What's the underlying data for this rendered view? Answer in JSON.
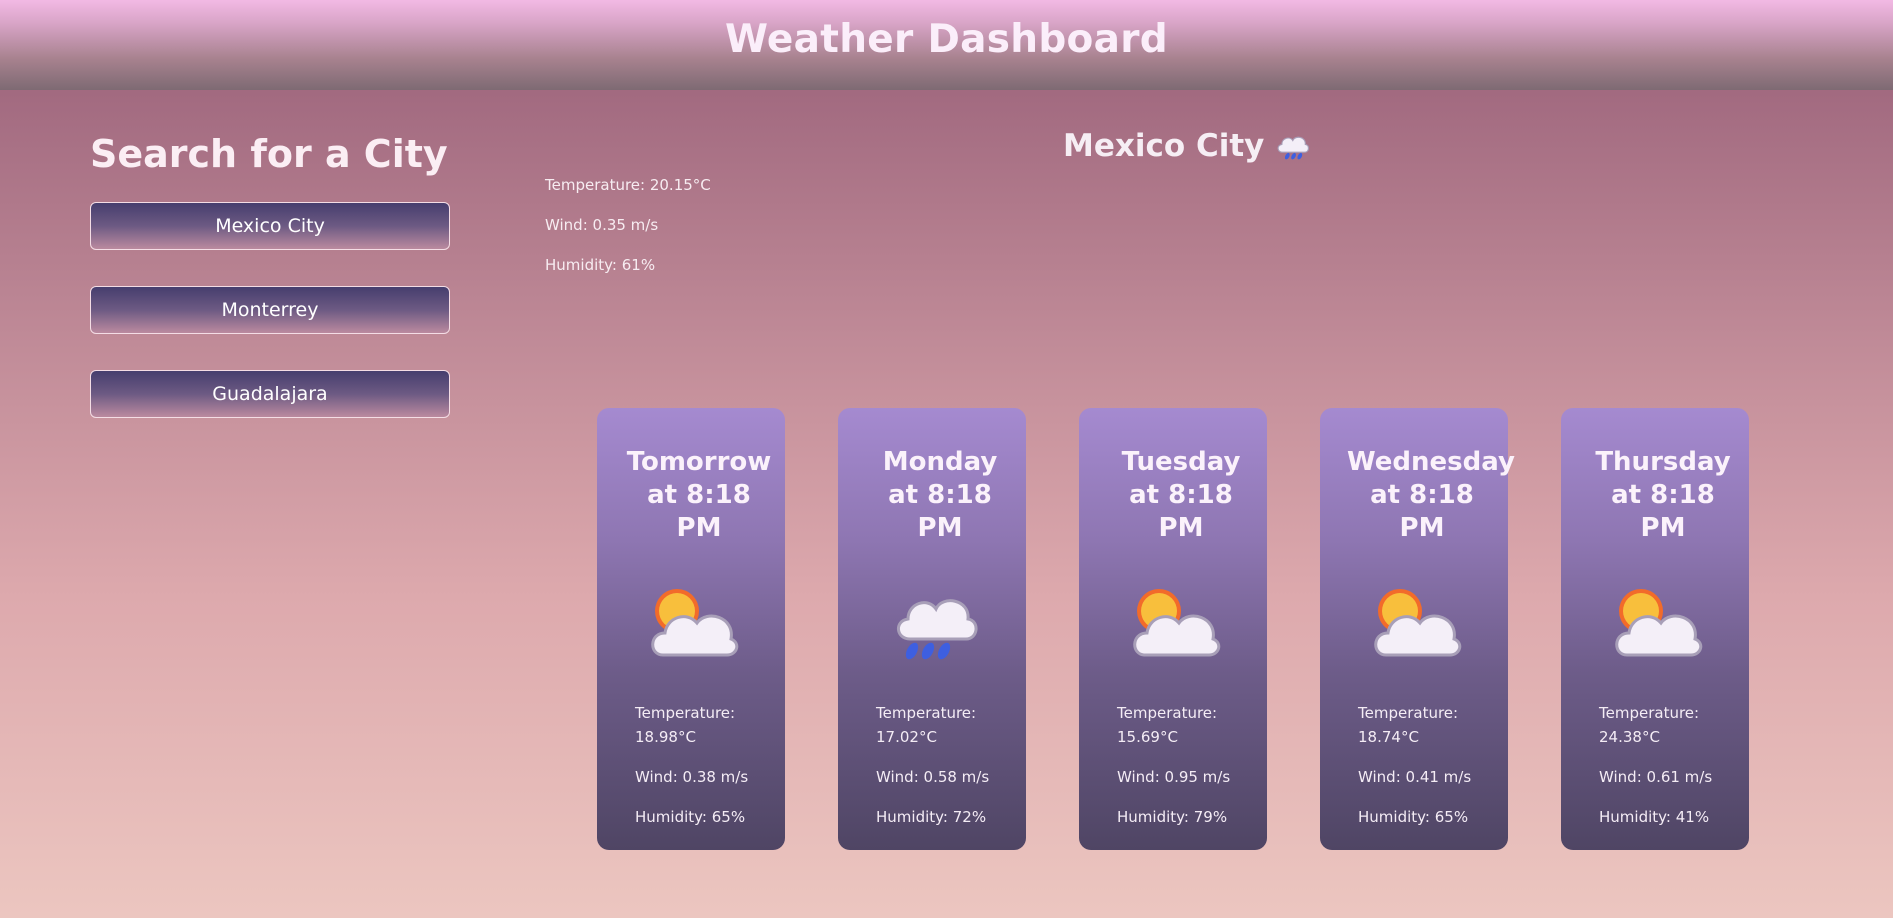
{
  "header": {
    "title": "Weather Dashboard"
  },
  "search": {
    "heading": "Search for a City",
    "cities": [
      "Mexico City",
      "Monterrey",
      "Guadalajara"
    ]
  },
  "current": {
    "city": "Mexico City",
    "icon": "rain-cloud-icon",
    "temperature": "Temperature: 20.15°C",
    "wind": "Wind: 0.35 m/s",
    "humidity": "Humidity: 61%"
  },
  "forecast": [
    {
      "day": "Tomorrow at 8:18 PM",
      "icon": "partly-cloudy-icon",
      "temperature": "Temperature: 18.98°C",
      "wind": "Wind: 0.38 m/s",
      "humidity": "Humidity: 65%"
    },
    {
      "day": "Monday at 8:18 PM",
      "icon": "rain-cloud-icon",
      "temperature": "Temperature: 17.02°C",
      "wind": "Wind: 0.58 m/s",
      "humidity": "Humidity: 72%"
    },
    {
      "day": "Tuesday at 8:18 PM",
      "icon": "partly-cloudy-icon",
      "temperature": "Temperature: 15.69°C",
      "wind": "Wind: 0.95 m/s",
      "humidity": "Humidity: 79%"
    },
    {
      "day": "Wednesday at 8:18 PM",
      "icon": "partly-cloudy-icon",
      "temperature": "Temperature: 18.74°C",
      "wind": "Wind: 0.41 m/s",
      "humidity": "Humidity: 65%"
    },
    {
      "day": "Thursday at 8:18 PM",
      "icon": "partly-cloudy-icon",
      "temperature": "Temperature: 24.38°C",
      "wind": "Wind: 0.61 m/s",
      "humidity": "Humidity: 41%"
    }
  ]
}
